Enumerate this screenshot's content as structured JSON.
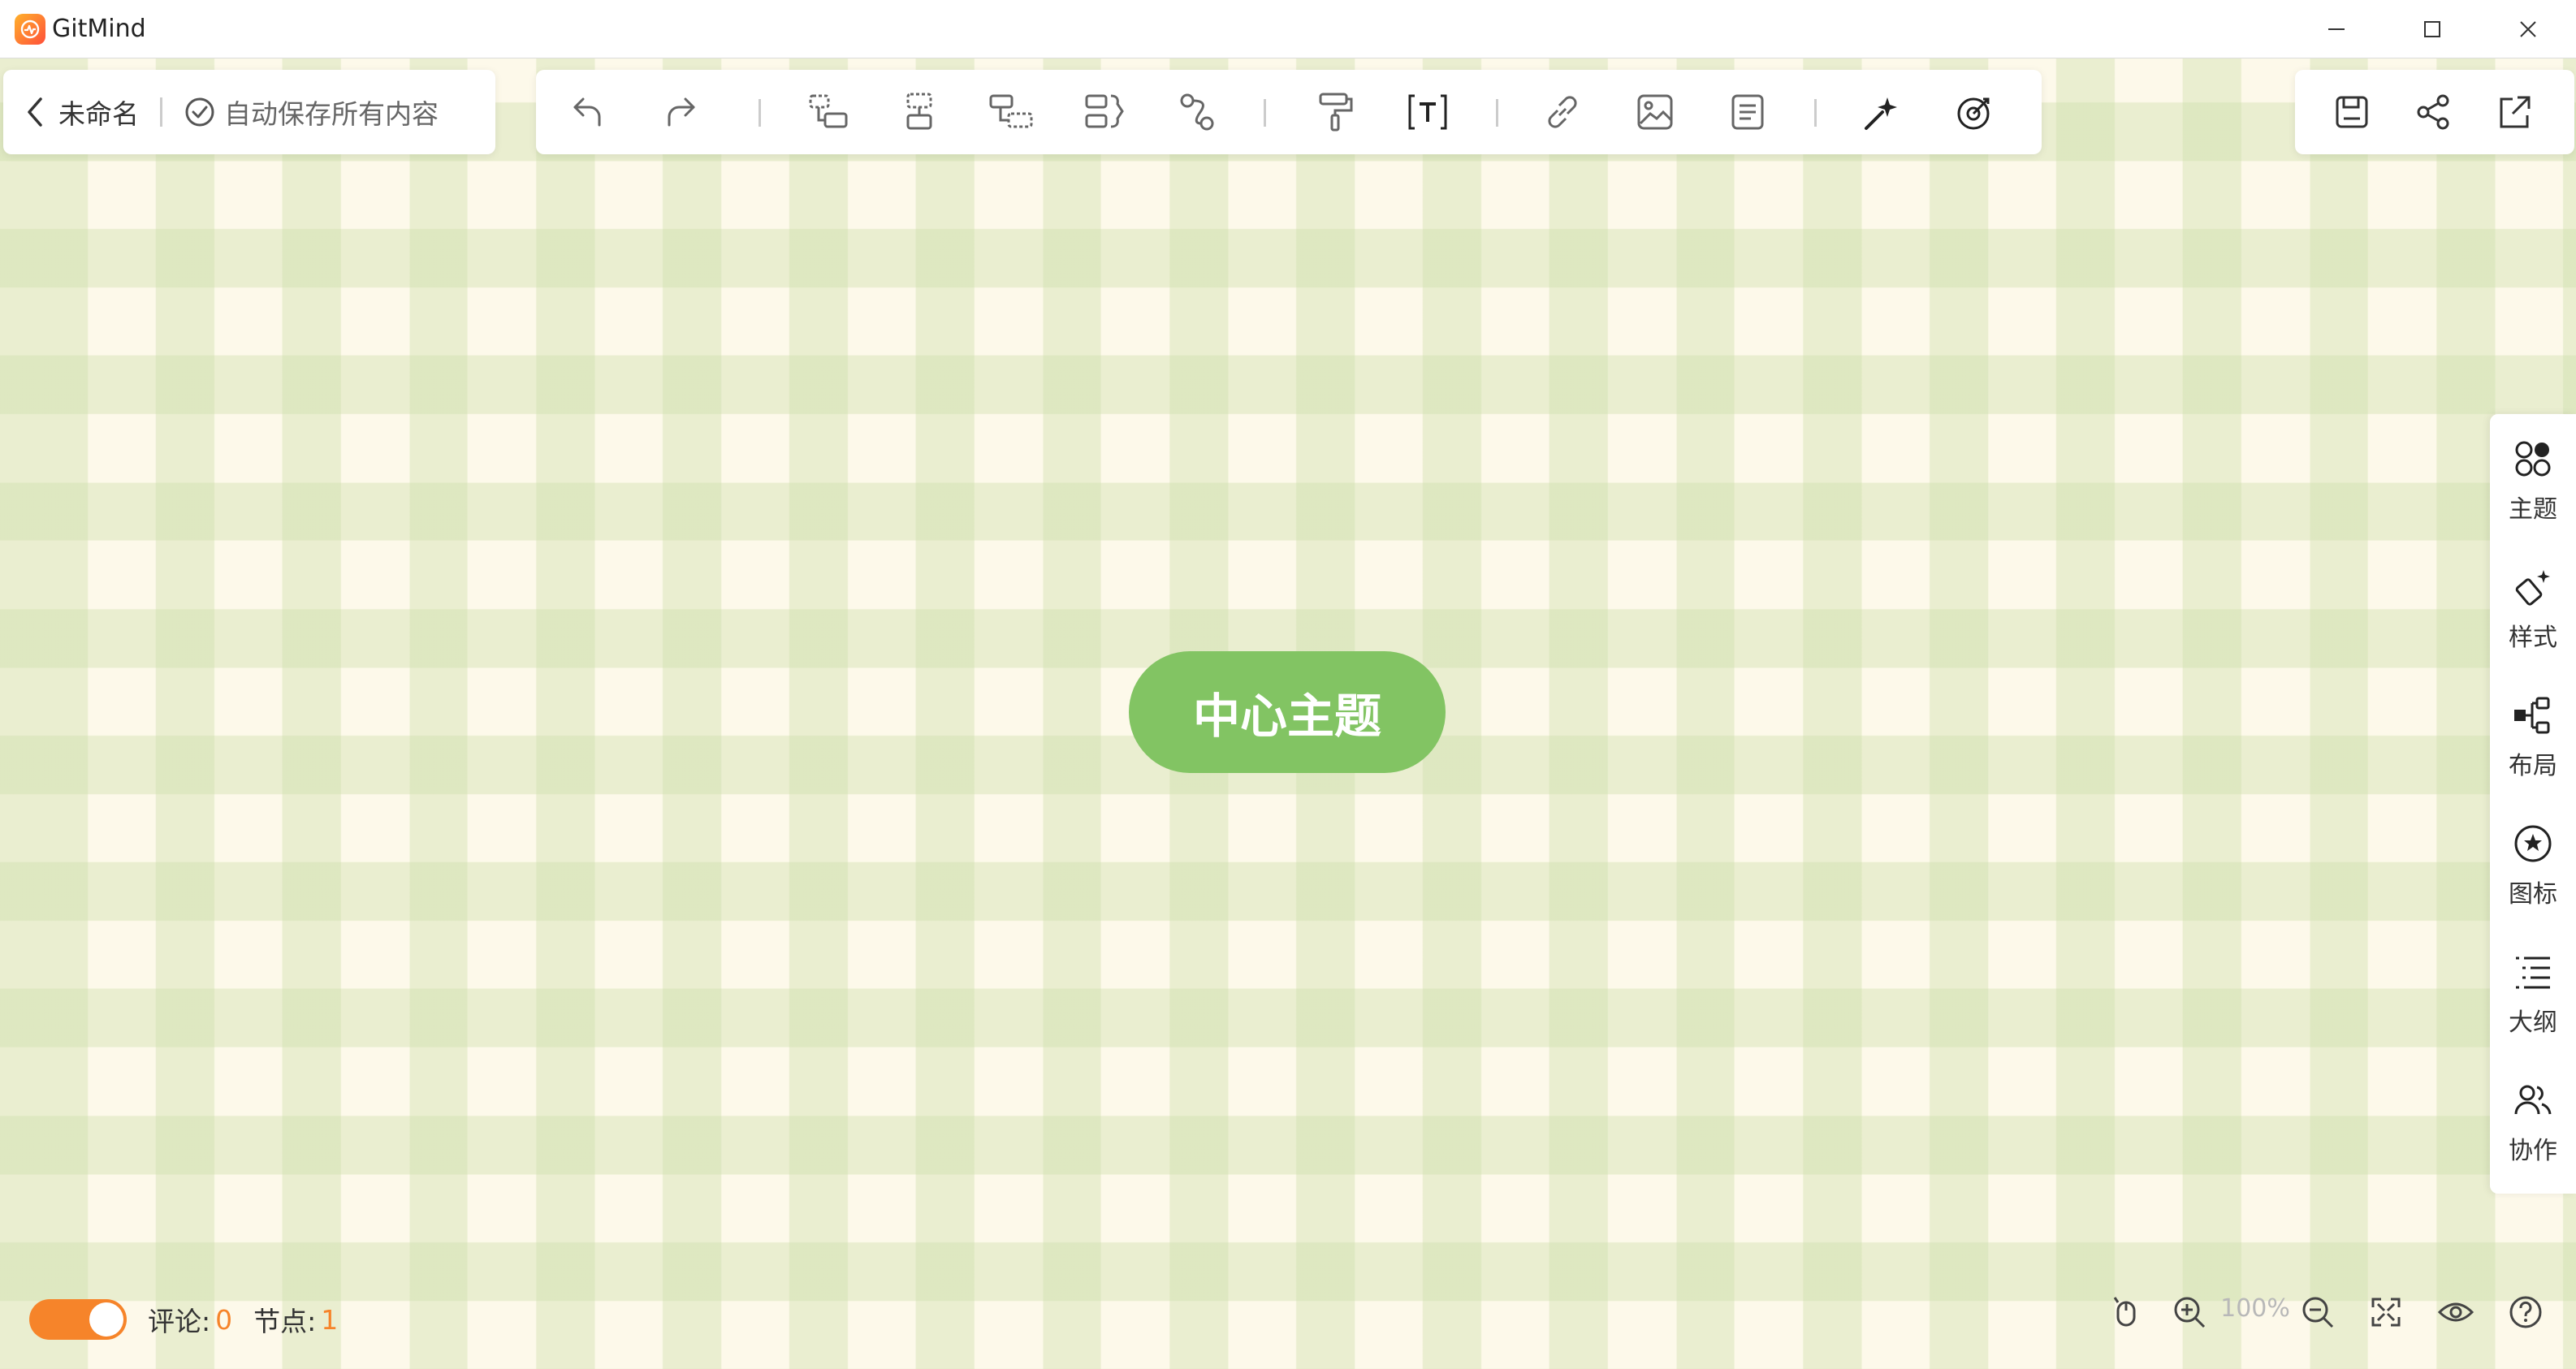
{
  "window": {
    "title": "GitMind",
    "controls": {
      "minimize": "minimize-icon",
      "maximize": "maximize-icon",
      "close": "close-icon"
    }
  },
  "header": {
    "back_label": "未命名",
    "save_status": "自动保存所有内容"
  },
  "toolbar": {
    "tools": [
      "undo-icon",
      "redo-icon",
      "add-child-topic-icon",
      "add-sibling-topic-icon",
      "add-parent-topic-icon",
      "add-summary-icon",
      "add-relation-icon",
      "format-painter-icon",
      "text-icon",
      "link-icon",
      "image-icon",
      "note-icon",
      "magic-wand-icon",
      "target-icon"
    ]
  },
  "header_right": {
    "actions": [
      "save-icon",
      "share-icon",
      "export-icon"
    ]
  },
  "sidebar": {
    "items": [
      {
        "label": "主题",
        "icon": "theme-icon"
      },
      {
        "label": "样式",
        "icon": "style-icon"
      },
      {
        "label": "布局",
        "icon": "layout-icon"
      },
      {
        "label": "图标",
        "icon": "sticker-icon"
      },
      {
        "label": "大纲",
        "icon": "outline-icon"
      },
      {
        "label": "协作",
        "icon": "collaborate-icon"
      }
    ]
  },
  "canvas": {
    "central_topic": "中心主题"
  },
  "status": {
    "comments_label": "评论:",
    "comments_count": "0",
    "nodes_label": "节点:",
    "nodes_count": "1",
    "toggle_on": true
  },
  "zoom": {
    "value": "100%"
  },
  "colors": {
    "accent": "#f6842a",
    "topic": "#82c463",
    "canvas": "#fdf9ea"
  }
}
